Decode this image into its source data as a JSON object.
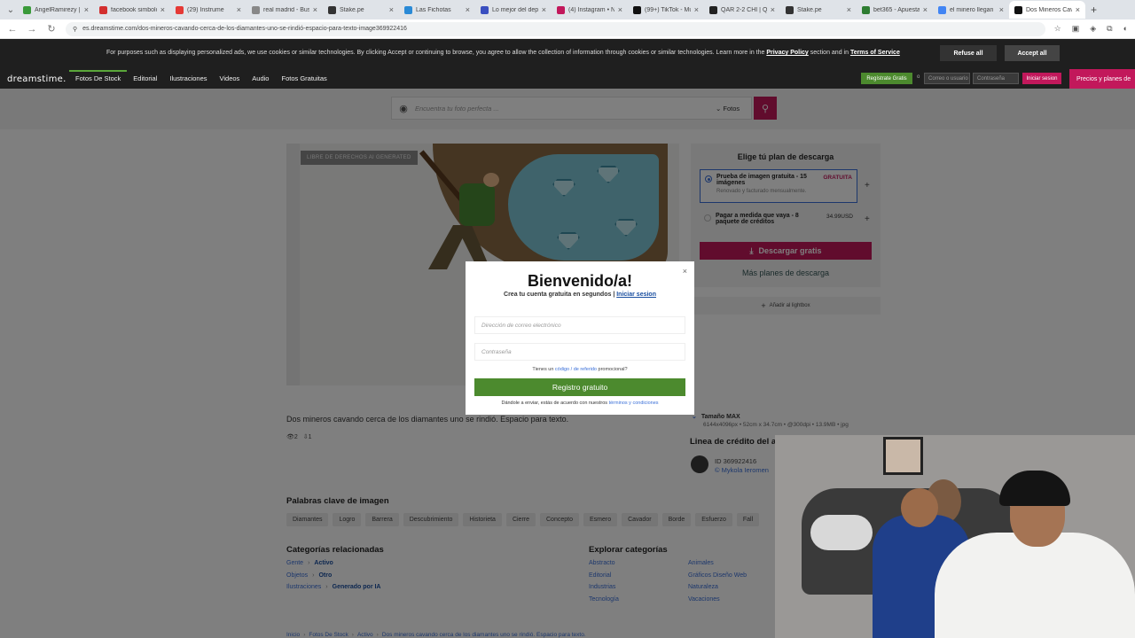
{
  "browser": {
    "tabs": [
      {
        "title": "AngelRamirezy |",
        "color": "#3a9a3a"
      },
      {
        "title": "facebook simbolo",
        "color": "#d32f2f"
      },
      {
        "title": "(29) Instrume",
        "color": "#e53935"
      },
      {
        "title": "real madrid - Bus",
        "color": "#888888"
      },
      {
        "title": "Stake.pe",
        "color": "#333333"
      },
      {
        "title": "Las Fichotas",
        "color": "#2a8ad6"
      },
      {
        "title": "Lo mejor del dep",
        "color": "#3a4fc0"
      },
      {
        "title": "(4) Instagram • N",
        "color": "#c2185b"
      },
      {
        "title": "(99+) TikTok - Mus",
        "color": "#111111"
      },
      {
        "title": "QAR 2-2 CHI | Q",
        "color": "#222222"
      },
      {
        "title": "Stake.pe",
        "color": "#333333"
      },
      {
        "title": "bet365 - Apuesta",
        "color": "#2e7d32"
      },
      {
        "title": "el minero llegan",
        "color": "#4285f4"
      },
      {
        "title": "Dos Mineros Cav",
        "color": "#111111"
      }
    ],
    "url": "es.dreamstime.com/dos-mineros-cavando-cerca-de-los-diamantes-uno-se-rindió-espacio-para-texto-image369922416"
  },
  "cookie": {
    "text": "For purposes such as displaying personalized ads, we use cookies or similar technologies. By clicking Accept or continuing to browse, you agree to allow the collection of information through cookies or similar technologies. Learn more in the",
    "privacy": "Privacy Policy",
    "mid": "section and in",
    "terms": "Terms of Service",
    "refuse": "Refuse all",
    "accept": "Accept all"
  },
  "header": {
    "logo": "dreamstime.",
    "nav": [
      "Fotos De Stock",
      "Editorial",
      "Ilustraciones",
      "Videos",
      "Audio",
      "Fotos Gratuitas"
    ],
    "register": "Regístrate Gratis",
    "or": "o",
    "user_placeholder": "Correo o usuario",
    "pass_placeholder": "Contraseña",
    "login": "Iniciar sesion",
    "pricing": "Precios y planes de"
  },
  "search": {
    "placeholder": "Encuentra tu foto perfecta ...",
    "category": "Fotos"
  },
  "image": {
    "badge": "LIBRE DE DERECHOS AI GENERATED",
    "caption": "Dos mineros cavando cerca de los diamantes uno se rindió. Espacio para texto.",
    "stat1": "2",
    "stat2": "1"
  },
  "plans": {
    "title": "Elige tú plan de descarga",
    "opt1_title": "Prueba de imagen gratuita - 15 imágenes",
    "opt1_sub": "Renovado y facturado mensualmente.",
    "opt1_price": "GRATUITA",
    "opt2_title": "Pagar a medida que vaya - 8 paquete de créditos",
    "opt2_price": "34.99USD",
    "download": "Descargar gratis",
    "more": "Más planes de descarga",
    "lightbox": "Añadir al lightbox"
  },
  "details": {
    "size_title": "Tamaño MAX",
    "size_desc": "6144x4096px • 52cm x 34.7cm • @300dpi • 13.9MB • jpg",
    "credit_title": "Linea de crédito del a",
    "author_id": "ID 369922416",
    "author_name": "© Mykola Ieromen"
  },
  "keywords": {
    "title": "Palabras clave de imagen",
    "items": [
      "Diamantes",
      "Logro",
      "Barrera",
      "Descubrimiento",
      "Historieta",
      "Cierre",
      "Concepto",
      "Esmero",
      "Cavador",
      "Borde",
      "Esfuerzo",
      "Fall"
    ]
  },
  "categories": {
    "title": "Categorías relacionadas",
    "rows": [
      {
        "a": "Gente",
        "b": "Activo"
      },
      {
        "a": "Objetos",
        "b": "Otro"
      },
      {
        "a": "Ilustraciones",
        "b": "Generado por IA"
      }
    ],
    "explore_title": "Explorar categorías",
    "explore": [
      "Abstracto",
      "Editorial",
      "Industrias",
      "Tecnología",
      "Animales",
      "Gráficos Diseño Web",
      "Naturaleza",
      "Vacaciones"
    ]
  },
  "breadcrumb": [
    "Inicio",
    "Fotos De Stock",
    "Activo",
    "Dos mineros cavando cerca de los diamantes uno se rindió. Espacio para texto."
  ],
  "modal": {
    "title": "Bienvenido/a!",
    "sub": "Crea tu cuenta gratuita en segundos |",
    "login_link": "Iniciar sesion",
    "email_placeholder": "Dirección de correo electrónico",
    "password_placeholder": "Contraseña",
    "ref_pre": "Tienes un",
    "ref_link": "código / de referido",
    "ref_post": "promocional?",
    "register": "Registro gratuito",
    "terms_pre": "Dándole a enviar, estás de acuerdo con nuestros",
    "terms_link": "términos y condiciones"
  }
}
